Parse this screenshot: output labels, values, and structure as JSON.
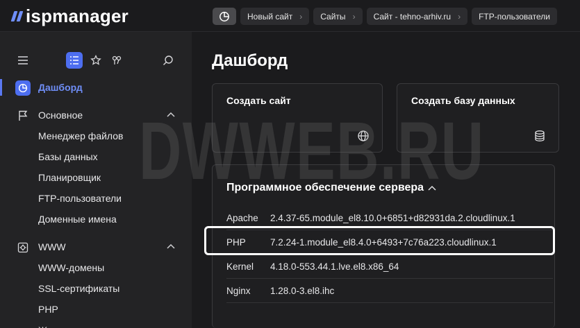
{
  "app": {
    "logo_text": "ispmanager"
  },
  "tabs": [
    {
      "label": "Новый сайт"
    },
    {
      "label": "Сайты"
    },
    {
      "label": "Сайт - tehno-arhiv.ru"
    },
    {
      "label": "FTP-пользователи"
    }
  ],
  "sidebar": {
    "dashboard_label": "Дашборд",
    "section_main": "Основное",
    "main_items": [
      "Менеджер файлов",
      "Базы данных",
      "Планировщик",
      "FTP-пользователи",
      "Доменные имена"
    ],
    "section_www": "WWW",
    "www_items": [
      "WWW-домены",
      "SSL-сертификаты",
      "PHP",
      "Ж"
    ]
  },
  "main": {
    "title": "Дашборд",
    "card_create_site": "Создать сайт",
    "card_create_db": "Создать базу данных",
    "software": {
      "title": "Программное обеспечение сервера",
      "rows": [
        {
          "name": "Apache",
          "version": "2.4.37-65.module_el8.10.0+6851+d82931da.2.cloudlinux.1"
        },
        {
          "name": "PHP",
          "version": "7.2.24-1.module_el8.4.0+6493+7c76a223.cloudlinux.1"
        },
        {
          "name": "Kernel",
          "version": "4.18.0-553.44.1.lve.el8.x86_64"
        },
        {
          "name": "Nginx",
          "version": "1.28.0-3.el8.ihc"
        }
      ]
    }
  },
  "watermark": "DWWEB.RU",
  "colors": {
    "accent": "#4d6ef0",
    "sidebar_bg": "#232325",
    "main_bg": "#1b1b1d"
  }
}
